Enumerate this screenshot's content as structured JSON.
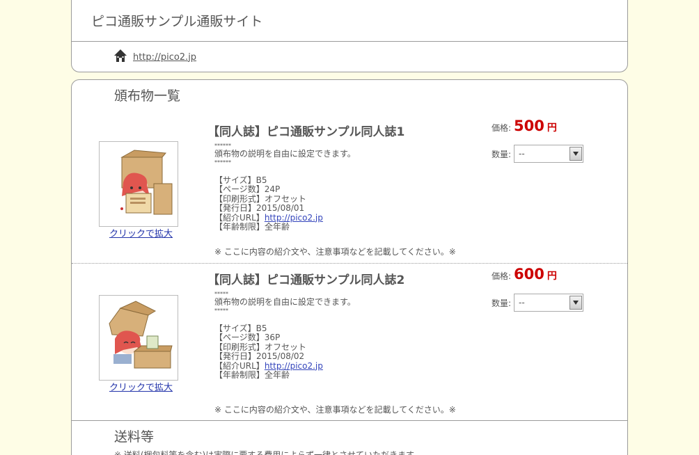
{
  "header": {
    "site_title": "ピコ通販サンプル通販サイト",
    "home_link": "http://pico2.jp"
  },
  "catalog": {
    "section_title": "頒布物一覧",
    "enlarge_label": "クリックで拡大",
    "price_label": "価格:",
    "price_unit": "円",
    "qty_label": "数量:",
    "products": [
      {
        "title": "【同人誌】ピコ通販サンプル同人誌1",
        "price": "500",
        "qty_value": "--",
        "stars_top": "******",
        "description": "頒布物の説明を自由に設定できます。",
        "stars_bottom": "******",
        "specs": [
          "【サイズ】B5",
          "【ページ数】24P",
          "【印刷形式】オフセット",
          "【発行日】2015/08/01"
        ],
        "url_label": "【紹介URL】",
        "url": "http://pico2.jp",
        "age": "【年齢制限】全年齢",
        "note": "※ ここに内容の紹介文や、注意事項などを記載してください。※"
      },
      {
        "title": "【同人誌】ピコ通販サンプル同人誌2",
        "price": "600",
        "qty_value": "--",
        "stars_top": "*****",
        "description": "頒布物の説明を自由に設定できます。",
        "stars_bottom": "*****",
        "specs": [
          "【サイズ】B5",
          "【ページ数】36P",
          "【印刷形式】オフセット",
          "【発行日】2015/08/02"
        ],
        "url_label": "【紹介URL】",
        "url": "http://pico2.jp",
        "age": "【年齢制限】全年齢",
        "note": "※ ここに内容の紹介文や、注意事項などを記載してください。※"
      }
    ]
  },
  "shipping": {
    "section_title": "送料等",
    "note": "※ 送料(梱包料等を含む)は実際に要する費用によらず一律とさせていただきます。"
  },
  "icons": {
    "home": "home-icon",
    "dropdown": "chevron-down-icon"
  }
}
